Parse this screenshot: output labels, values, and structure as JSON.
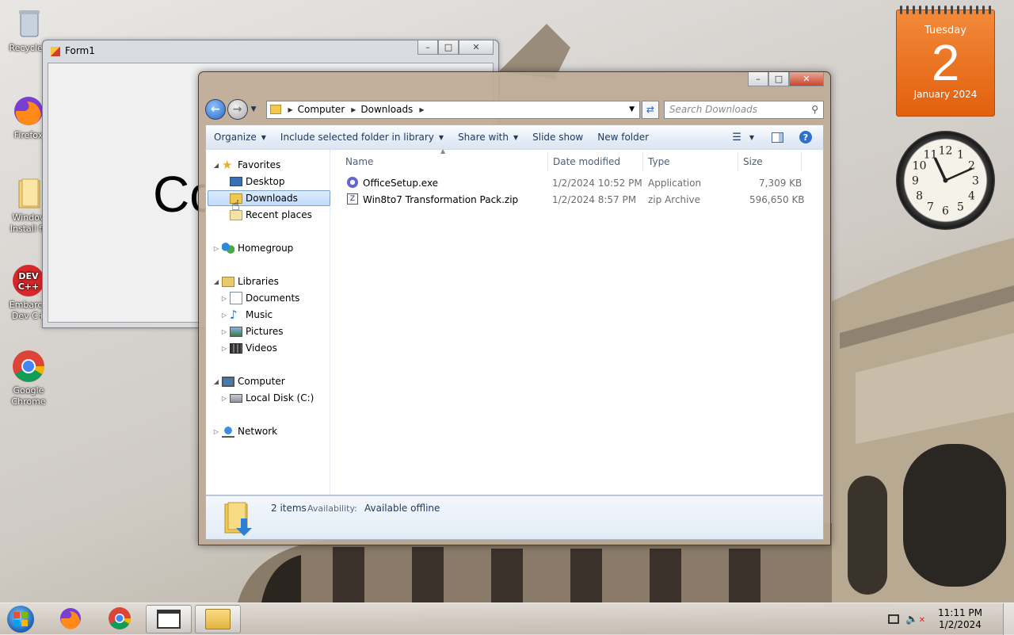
{
  "desktop": {
    "icons": [
      {
        "label": "Recycle I"
      },
      {
        "label": "Firefox"
      },
      {
        "label": "Windov Install fil"
      },
      {
        "label": "Embarca Dev C+"
      },
      {
        "label": "Google Chrome"
      }
    ]
  },
  "form1": {
    "title": "Form1",
    "big_text": "Co"
  },
  "explorer": {
    "breadcrumb": [
      "Computer",
      "Downloads"
    ],
    "search_placeholder": "Search Downloads",
    "toolbar": {
      "organize": "Organize",
      "include_library": "Include selected folder in library",
      "share_with": "Share with",
      "slide_show": "Slide show",
      "new_folder": "New folder"
    },
    "nav": {
      "favorites": "Favorites",
      "desktop": "Desktop",
      "downloads": "Downloads",
      "recent": "Recent places",
      "homegroup": "Homegroup",
      "libraries": "Libraries",
      "documents": "Documents",
      "music": "Music",
      "pictures": "Pictures",
      "videos": "Videos",
      "computer": "Computer",
      "local_disk": "Local Disk (C:)",
      "network": "Network"
    },
    "columns": {
      "name": "Name",
      "date": "Date modified",
      "type": "Type",
      "size": "Size"
    },
    "files": [
      {
        "name": "OfficeSetup.exe",
        "date": "1/2/2024 10:52 PM",
        "type": "Application",
        "size": "7,309 KB",
        "icon": "office-setup-icon"
      },
      {
        "name": "Win8to7 Transformation Pack.zip",
        "date": "1/2/2024 8:57 PM",
        "type": "zip Archive",
        "size": "596,650 KB",
        "icon": "zip-archive-icon"
      }
    ],
    "details": {
      "count": "2 items",
      "availability_label": "Availability:",
      "availability_value": "Available offline"
    }
  },
  "gadgets": {
    "calendar": {
      "weekday": "Tuesday",
      "day": "2",
      "month_year": "January 2024"
    },
    "clock": {
      "numbers": [
        "12",
        "1",
        "2",
        "3",
        "4",
        "5",
        "6",
        "7",
        "8",
        "9",
        "10",
        "11"
      ]
    }
  },
  "taskbar": {
    "time": "11:11 PM",
    "date": "1/2/2024"
  },
  "colors": {
    "calendar_orange": "#e8701f",
    "explorer_frame": "#bfa995",
    "selection_blue": "#c1dbfc"
  }
}
